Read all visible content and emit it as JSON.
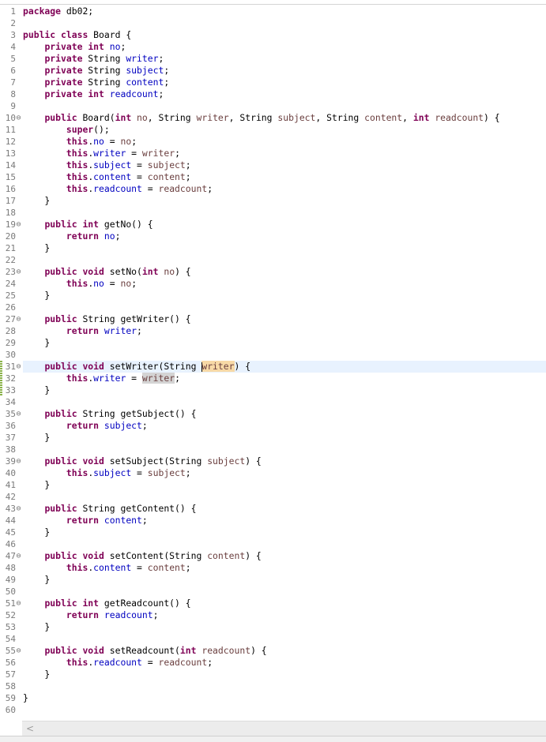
{
  "editor": {
    "active_line": 31,
    "lines": [
      {
        "n": 1,
        "tokens": [
          {
            "t": "kw",
            "v": "package"
          },
          {
            "v": " db02;"
          }
        ]
      },
      {
        "n": 2,
        "tokens": []
      },
      {
        "n": 3,
        "tokens": [
          {
            "t": "kw",
            "v": "public"
          },
          {
            "v": " "
          },
          {
            "t": "kw",
            "v": "class"
          },
          {
            "v": " Board {"
          }
        ]
      },
      {
        "n": 4,
        "tokens": [
          {
            "v": "    "
          },
          {
            "t": "kw",
            "v": "private"
          },
          {
            "v": " "
          },
          {
            "t": "kw",
            "v": "int"
          },
          {
            "v": " "
          },
          {
            "t": "fld",
            "v": "no"
          },
          {
            "v": ";"
          }
        ]
      },
      {
        "n": 5,
        "tokens": [
          {
            "v": "    "
          },
          {
            "t": "kw",
            "v": "private"
          },
          {
            "v": " String "
          },
          {
            "t": "fld",
            "v": "writer"
          },
          {
            "v": ";"
          }
        ]
      },
      {
        "n": 6,
        "tokens": [
          {
            "v": "    "
          },
          {
            "t": "kw",
            "v": "private"
          },
          {
            "v": " String "
          },
          {
            "t": "fld",
            "v": "subject"
          },
          {
            "v": ";"
          }
        ]
      },
      {
        "n": 7,
        "tokens": [
          {
            "v": "    "
          },
          {
            "t": "kw",
            "v": "private"
          },
          {
            "v": " String "
          },
          {
            "t": "fld",
            "v": "content"
          },
          {
            "v": ";"
          }
        ]
      },
      {
        "n": 8,
        "tokens": [
          {
            "v": "    "
          },
          {
            "t": "kw",
            "v": "private"
          },
          {
            "v": " "
          },
          {
            "t": "kw",
            "v": "int"
          },
          {
            "v": " "
          },
          {
            "t": "fld",
            "v": "readcount"
          },
          {
            "v": ";"
          }
        ]
      },
      {
        "n": 9,
        "tokens": []
      },
      {
        "n": 10,
        "fold": true,
        "tokens": [
          {
            "v": "    "
          },
          {
            "t": "kw",
            "v": "public"
          },
          {
            "v": " Board("
          },
          {
            "t": "kw",
            "v": "int"
          },
          {
            "v": " "
          },
          {
            "t": "prm",
            "v": "no"
          },
          {
            "v": ", String "
          },
          {
            "t": "prm",
            "v": "writer"
          },
          {
            "v": ", String "
          },
          {
            "t": "prm",
            "v": "subject"
          },
          {
            "v": ", String "
          },
          {
            "t": "prm",
            "v": "content"
          },
          {
            "v": ", "
          },
          {
            "t": "kw",
            "v": "int"
          },
          {
            "v": " "
          },
          {
            "t": "prm",
            "v": "readcount"
          },
          {
            "v": ") {"
          }
        ]
      },
      {
        "n": 11,
        "tokens": [
          {
            "v": "        "
          },
          {
            "t": "kw",
            "v": "super"
          },
          {
            "v": "();"
          }
        ]
      },
      {
        "n": 12,
        "tokens": [
          {
            "v": "        "
          },
          {
            "t": "kw",
            "v": "this"
          },
          {
            "v": "."
          },
          {
            "t": "fld",
            "v": "no"
          },
          {
            "v": " = "
          },
          {
            "t": "prm",
            "v": "no"
          },
          {
            "v": ";"
          }
        ]
      },
      {
        "n": 13,
        "tokens": [
          {
            "v": "        "
          },
          {
            "t": "kw",
            "v": "this"
          },
          {
            "v": "."
          },
          {
            "t": "fld",
            "v": "writer"
          },
          {
            "v": " = "
          },
          {
            "t": "prm",
            "v": "writer"
          },
          {
            "v": ";"
          }
        ]
      },
      {
        "n": 14,
        "tokens": [
          {
            "v": "        "
          },
          {
            "t": "kw",
            "v": "this"
          },
          {
            "v": "."
          },
          {
            "t": "fld",
            "v": "subject"
          },
          {
            "v": " = "
          },
          {
            "t": "prm",
            "v": "subject"
          },
          {
            "v": ";"
          }
        ]
      },
      {
        "n": 15,
        "tokens": [
          {
            "v": "        "
          },
          {
            "t": "kw",
            "v": "this"
          },
          {
            "v": "."
          },
          {
            "t": "fld",
            "v": "content"
          },
          {
            "v": " = "
          },
          {
            "t": "prm",
            "v": "content"
          },
          {
            "v": ";"
          }
        ]
      },
      {
        "n": 16,
        "tokens": [
          {
            "v": "        "
          },
          {
            "t": "kw",
            "v": "this"
          },
          {
            "v": "."
          },
          {
            "t": "fld",
            "v": "readcount"
          },
          {
            "v": " = "
          },
          {
            "t": "prm",
            "v": "readcount"
          },
          {
            "v": ";"
          }
        ]
      },
      {
        "n": 17,
        "tokens": [
          {
            "v": "    }"
          }
        ]
      },
      {
        "n": 18,
        "tokens": []
      },
      {
        "n": 19,
        "fold": true,
        "tokens": [
          {
            "v": "    "
          },
          {
            "t": "kw",
            "v": "public"
          },
          {
            "v": " "
          },
          {
            "t": "kw",
            "v": "int"
          },
          {
            "v": " getNo() {"
          }
        ]
      },
      {
        "n": 20,
        "tokens": [
          {
            "v": "        "
          },
          {
            "t": "kw",
            "v": "return"
          },
          {
            "v": " "
          },
          {
            "t": "fld",
            "v": "no"
          },
          {
            "v": ";"
          }
        ]
      },
      {
        "n": 21,
        "tokens": [
          {
            "v": "    }"
          }
        ]
      },
      {
        "n": 22,
        "tokens": []
      },
      {
        "n": 23,
        "fold": true,
        "tokens": [
          {
            "v": "    "
          },
          {
            "t": "kw",
            "v": "public"
          },
          {
            "v": " "
          },
          {
            "t": "kw",
            "v": "void"
          },
          {
            "v": " setNo("
          },
          {
            "t": "kw",
            "v": "int"
          },
          {
            "v": " "
          },
          {
            "t": "prm",
            "v": "no"
          },
          {
            "v": ") {"
          }
        ]
      },
      {
        "n": 24,
        "tokens": [
          {
            "v": "        "
          },
          {
            "t": "kw",
            "v": "this"
          },
          {
            "v": "."
          },
          {
            "t": "fld",
            "v": "no"
          },
          {
            "v": " = "
          },
          {
            "t": "prm",
            "v": "no"
          },
          {
            "v": ";"
          }
        ]
      },
      {
        "n": 25,
        "tokens": [
          {
            "v": "    }"
          }
        ]
      },
      {
        "n": 26,
        "tokens": []
      },
      {
        "n": 27,
        "fold": true,
        "tokens": [
          {
            "v": "    "
          },
          {
            "t": "kw",
            "v": "public"
          },
          {
            "v": " String getWriter() {"
          }
        ]
      },
      {
        "n": 28,
        "tokens": [
          {
            "v": "        "
          },
          {
            "t": "kw",
            "v": "return"
          },
          {
            "v": " "
          },
          {
            "t": "fld",
            "v": "writer"
          },
          {
            "v": ";"
          }
        ]
      },
      {
        "n": 29,
        "tokens": [
          {
            "v": "    }"
          }
        ]
      },
      {
        "n": 30,
        "tokens": []
      },
      {
        "n": 31,
        "fold": true,
        "tokens": [
          {
            "v": "    "
          },
          {
            "t": "kw",
            "v": "public"
          },
          {
            "v": " "
          },
          {
            "t": "kw",
            "v": "void"
          },
          {
            "v": " setWriter(String "
          },
          {
            "t": "prm",
            "v": "w",
            "h": "occ-w",
            "caret": true
          },
          {
            "t": "prm",
            "v": "riter",
            "h": "occ-w"
          },
          {
            "v": ") {"
          }
        ]
      },
      {
        "n": 32,
        "tokens": [
          {
            "v": "        "
          },
          {
            "t": "kw",
            "v": "this"
          },
          {
            "v": "."
          },
          {
            "t": "fld",
            "v": "writer"
          },
          {
            "v": " = "
          },
          {
            "t": "prm",
            "v": "writer",
            "h": "occ-r"
          },
          {
            "v": ";"
          }
        ]
      },
      {
        "n": 33,
        "tokens": [
          {
            "v": "    }"
          }
        ]
      },
      {
        "n": 34,
        "tokens": []
      },
      {
        "n": 35,
        "fold": true,
        "tokens": [
          {
            "v": "    "
          },
          {
            "t": "kw",
            "v": "public"
          },
          {
            "v": " String getSubject() {"
          }
        ]
      },
      {
        "n": 36,
        "tokens": [
          {
            "v": "        "
          },
          {
            "t": "kw",
            "v": "return"
          },
          {
            "v": " "
          },
          {
            "t": "fld",
            "v": "subject"
          },
          {
            "v": ";"
          }
        ]
      },
      {
        "n": 37,
        "tokens": [
          {
            "v": "    }"
          }
        ]
      },
      {
        "n": 38,
        "tokens": []
      },
      {
        "n": 39,
        "fold": true,
        "tokens": [
          {
            "v": "    "
          },
          {
            "t": "kw",
            "v": "public"
          },
          {
            "v": " "
          },
          {
            "t": "kw",
            "v": "void"
          },
          {
            "v": " setSubject(String "
          },
          {
            "t": "prm",
            "v": "subject"
          },
          {
            "v": ") {"
          }
        ]
      },
      {
        "n": 40,
        "tokens": [
          {
            "v": "        "
          },
          {
            "t": "kw",
            "v": "this"
          },
          {
            "v": "."
          },
          {
            "t": "fld",
            "v": "subject"
          },
          {
            "v": " = "
          },
          {
            "t": "prm",
            "v": "subject"
          },
          {
            "v": ";"
          }
        ]
      },
      {
        "n": 41,
        "tokens": [
          {
            "v": "    }"
          }
        ]
      },
      {
        "n": 42,
        "tokens": []
      },
      {
        "n": 43,
        "fold": true,
        "tokens": [
          {
            "v": "    "
          },
          {
            "t": "kw",
            "v": "public"
          },
          {
            "v": " String getContent() {"
          }
        ]
      },
      {
        "n": 44,
        "tokens": [
          {
            "v": "        "
          },
          {
            "t": "kw",
            "v": "return"
          },
          {
            "v": " "
          },
          {
            "t": "fld",
            "v": "content"
          },
          {
            "v": ";"
          }
        ]
      },
      {
        "n": 45,
        "tokens": [
          {
            "v": "    }"
          }
        ]
      },
      {
        "n": 46,
        "tokens": []
      },
      {
        "n": 47,
        "fold": true,
        "tokens": [
          {
            "v": "    "
          },
          {
            "t": "kw",
            "v": "public"
          },
          {
            "v": " "
          },
          {
            "t": "kw",
            "v": "void"
          },
          {
            "v": " setContent(String "
          },
          {
            "t": "prm",
            "v": "content"
          },
          {
            "v": ") {"
          }
        ]
      },
      {
        "n": 48,
        "tokens": [
          {
            "v": "        "
          },
          {
            "t": "kw",
            "v": "this"
          },
          {
            "v": "."
          },
          {
            "t": "fld",
            "v": "content"
          },
          {
            "v": " = "
          },
          {
            "t": "prm",
            "v": "content"
          },
          {
            "v": ";"
          }
        ]
      },
      {
        "n": 49,
        "tokens": [
          {
            "v": "    }"
          }
        ]
      },
      {
        "n": 50,
        "tokens": []
      },
      {
        "n": 51,
        "fold": true,
        "tokens": [
          {
            "v": "    "
          },
          {
            "t": "kw",
            "v": "public"
          },
          {
            "v": " "
          },
          {
            "t": "kw",
            "v": "int"
          },
          {
            "v": " getReadcount() {"
          }
        ]
      },
      {
        "n": 52,
        "tokens": [
          {
            "v": "        "
          },
          {
            "t": "kw",
            "v": "return"
          },
          {
            "v": " "
          },
          {
            "t": "fld",
            "v": "readcount"
          },
          {
            "v": ";"
          }
        ]
      },
      {
        "n": 53,
        "tokens": [
          {
            "v": "    }"
          }
        ]
      },
      {
        "n": 54,
        "tokens": []
      },
      {
        "n": 55,
        "fold": true,
        "tokens": [
          {
            "v": "    "
          },
          {
            "t": "kw",
            "v": "public"
          },
          {
            "v": " "
          },
          {
            "t": "kw",
            "v": "void"
          },
          {
            "v": " setReadcount("
          },
          {
            "t": "kw",
            "v": "int"
          },
          {
            "v": " "
          },
          {
            "t": "prm",
            "v": "readcount"
          },
          {
            "v": ") {"
          }
        ]
      },
      {
        "n": 56,
        "tokens": [
          {
            "v": "        "
          },
          {
            "t": "kw",
            "v": "this"
          },
          {
            "v": "."
          },
          {
            "t": "fld",
            "v": "readcount"
          },
          {
            "v": " = "
          },
          {
            "t": "prm",
            "v": "readcount"
          },
          {
            "v": ";"
          }
        ]
      },
      {
        "n": 57,
        "tokens": [
          {
            "v": "    }"
          }
        ]
      },
      {
        "n": 58,
        "tokens": []
      },
      {
        "n": 59,
        "tokens": [
          {
            "v": "}"
          }
        ]
      },
      {
        "n": 60,
        "tokens": []
      }
    ],
    "changed_lines": [
      31,
      32,
      33
    ]
  },
  "scrollbar": {
    "left_arrow": "<"
  },
  "colors": {
    "keyword": "#7f0055",
    "field": "#0000c0",
    "parameter": "#6a3e3e",
    "active_line_bg": "#e8f2fe",
    "occurrence_write": "#f7d9a6",
    "occurrence_read": "#d4d4d4",
    "line_number": "#7a7a7a"
  },
  "icons": {
    "fold": "collapse-minus-icon"
  }
}
